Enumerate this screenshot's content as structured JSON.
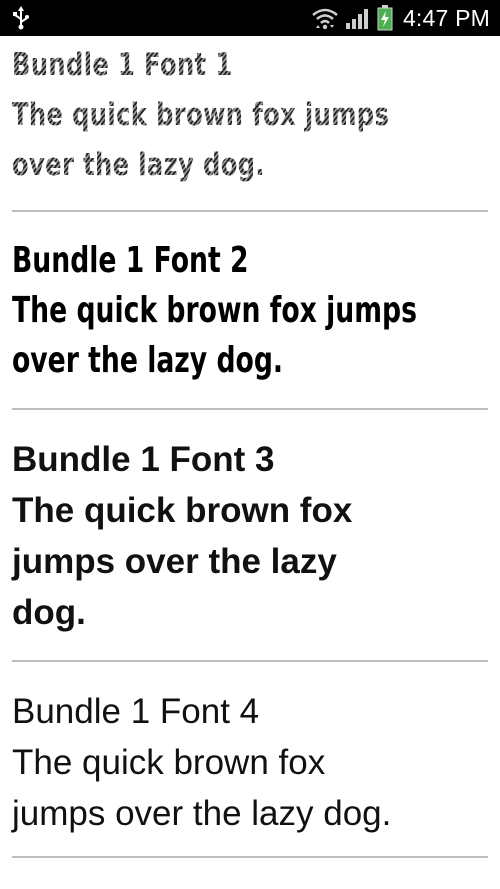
{
  "status_bar": {
    "time": "4:47 PM",
    "icons": [
      "usb-icon",
      "wifi-icon",
      "signal-icon",
      "battery-charging-icon"
    ]
  },
  "fonts": [
    {
      "name": "Bundle 1 Font 1",
      "line1": "The quick brown fox jumps",
      "line2": "over the lazy dog."
    },
    {
      "name": "Bundle 1 Font 2",
      "line1": "The quick brown fox jumps",
      "line2": "over the lazy dog."
    },
    {
      "name": "Bundle 1 Font 3",
      "line1": "The quick brown fox",
      "line2": "jumps over the lazy",
      "line3": "dog."
    },
    {
      "name": "Bundle 1 Font 4",
      "line1": "The quick brown fox",
      "line2": "jumps over the lazy dog."
    }
  ],
  "colors": {
    "status_bar_bg": "#000000",
    "battery_green": "#4caf50",
    "divider": "#bdbdbd"
  }
}
